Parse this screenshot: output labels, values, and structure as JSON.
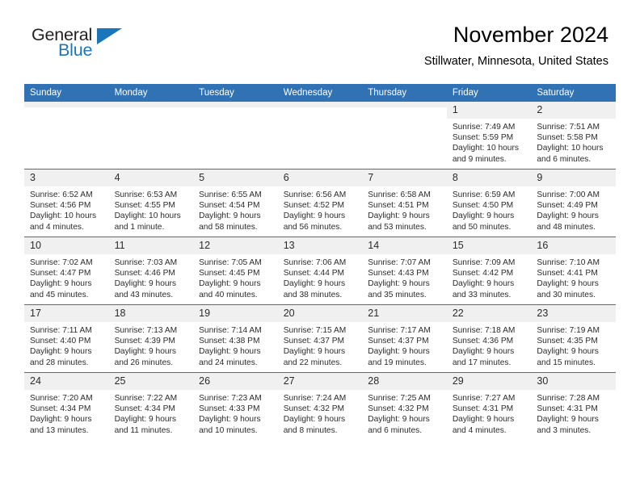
{
  "brand": {
    "name_part1": "General",
    "name_part2": "Blue",
    "flag_icon": "blue-triangle-flag",
    "accent_color": "#1b75bb"
  },
  "header": {
    "month_title": "November 2024",
    "location": "Stillwater, Minnesota, United States"
  },
  "calendar": {
    "header_color": "#3072b3",
    "daynum_band_color": "#f0f0f0",
    "weekday_headers": [
      "Sunday",
      "Monday",
      "Tuesday",
      "Wednesday",
      "Thursday",
      "Friday",
      "Saturday"
    ],
    "weeks": [
      [
        {
          "day": "",
          "empty": true
        },
        {
          "day": "",
          "empty": true
        },
        {
          "day": "",
          "empty": true
        },
        {
          "day": "",
          "empty": true
        },
        {
          "day": "",
          "empty": true
        },
        {
          "day": "1",
          "sunrise": "Sunrise: 7:49 AM",
          "sunset": "Sunset: 5:59 PM",
          "daylight": "Daylight: 10 hours and 9 minutes."
        },
        {
          "day": "2",
          "sunrise": "Sunrise: 7:51 AM",
          "sunset": "Sunset: 5:58 PM",
          "daylight": "Daylight: 10 hours and 6 minutes."
        }
      ],
      [
        {
          "day": "3",
          "sunrise": "Sunrise: 6:52 AM",
          "sunset": "Sunset: 4:56 PM",
          "daylight": "Daylight: 10 hours and 4 minutes."
        },
        {
          "day": "4",
          "sunrise": "Sunrise: 6:53 AM",
          "sunset": "Sunset: 4:55 PM",
          "daylight": "Daylight: 10 hours and 1 minute."
        },
        {
          "day": "5",
          "sunrise": "Sunrise: 6:55 AM",
          "sunset": "Sunset: 4:54 PM",
          "daylight": "Daylight: 9 hours and 58 minutes."
        },
        {
          "day": "6",
          "sunrise": "Sunrise: 6:56 AM",
          "sunset": "Sunset: 4:52 PM",
          "daylight": "Daylight: 9 hours and 56 minutes."
        },
        {
          "day": "7",
          "sunrise": "Sunrise: 6:58 AM",
          "sunset": "Sunset: 4:51 PM",
          "daylight": "Daylight: 9 hours and 53 minutes."
        },
        {
          "day": "8",
          "sunrise": "Sunrise: 6:59 AM",
          "sunset": "Sunset: 4:50 PM",
          "daylight": "Daylight: 9 hours and 50 minutes."
        },
        {
          "day": "9",
          "sunrise": "Sunrise: 7:00 AM",
          "sunset": "Sunset: 4:49 PM",
          "daylight": "Daylight: 9 hours and 48 minutes."
        }
      ],
      [
        {
          "day": "10",
          "sunrise": "Sunrise: 7:02 AM",
          "sunset": "Sunset: 4:47 PM",
          "daylight": "Daylight: 9 hours and 45 minutes."
        },
        {
          "day": "11",
          "sunrise": "Sunrise: 7:03 AM",
          "sunset": "Sunset: 4:46 PM",
          "daylight": "Daylight: 9 hours and 43 minutes."
        },
        {
          "day": "12",
          "sunrise": "Sunrise: 7:05 AM",
          "sunset": "Sunset: 4:45 PM",
          "daylight": "Daylight: 9 hours and 40 minutes."
        },
        {
          "day": "13",
          "sunrise": "Sunrise: 7:06 AM",
          "sunset": "Sunset: 4:44 PM",
          "daylight": "Daylight: 9 hours and 38 minutes."
        },
        {
          "day": "14",
          "sunrise": "Sunrise: 7:07 AM",
          "sunset": "Sunset: 4:43 PM",
          "daylight": "Daylight: 9 hours and 35 minutes."
        },
        {
          "day": "15",
          "sunrise": "Sunrise: 7:09 AM",
          "sunset": "Sunset: 4:42 PM",
          "daylight": "Daylight: 9 hours and 33 minutes."
        },
        {
          "day": "16",
          "sunrise": "Sunrise: 7:10 AM",
          "sunset": "Sunset: 4:41 PM",
          "daylight": "Daylight: 9 hours and 30 minutes."
        }
      ],
      [
        {
          "day": "17",
          "sunrise": "Sunrise: 7:11 AM",
          "sunset": "Sunset: 4:40 PM",
          "daylight": "Daylight: 9 hours and 28 minutes."
        },
        {
          "day": "18",
          "sunrise": "Sunrise: 7:13 AM",
          "sunset": "Sunset: 4:39 PM",
          "daylight": "Daylight: 9 hours and 26 minutes."
        },
        {
          "day": "19",
          "sunrise": "Sunrise: 7:14 AM",
          "sunset": "Sunset: 4:38 PM",
          "daylight": "Daylight: 9 hours and 24 minutes."
        },
        {
          "day": "20",
          "sunrise": "Sunrise: 7:15 AM",
          "sunset": "Sunset: 4:37 PM",
          "daylight": "Daylight: 9 hours and 22 minutes."
        },
        {
          "day": "21",
          "sunrise": "Sunrise: 7:17 AM",
          "sunset": "Sunset: 4:37 PM",
          "daylight": "Daylight: 9 hours and 19 minutes."
        },
        {
          "day": "22",
          "sunrise": "Sunrise: 7:18 AM",
          "sunset": "Sunset: 4:36 PM",
          "daylight": "Daylight: 9 hours and 17 minutes."
        },
        {
          "day": "23",
          "sunrise": "Sunrise: 7:19 AM",
          "sunset": "Sunset: 4:35 PM",
          "daylight": "Daylight: 9 hours and 15 minutes."
        }
      ],
      [
        {
          "day": "24",
          "sunrise": "Sunrise: 7:20 AM",
          "sunset": "Sunset: 4:34 PM",
          "daylight": "Daylight: 9 hours and 13 minutes."
        },
        {
          "day": "25",
          "sunrise": "Sunrise: 7:22 AM",
          "sunset": "Sunset: 4:34 PM",
          "daylight": "Daylight: 9 hours and 11 minutes."
        },
        {
          "day": "26",
          "sunrise": "Sunrise: 7:23 AM",
          "sunset": "Sunset: 4:33 PM",
          "daylight": "Daylight: 9 hours and 10 minutes."
        },
        {
          "day": "27",
          "sunrise": "Sunrise: 7:24 AM",
          "sunset": "Sunset: 4:32 PM",
          "daylight": "Daylight: 9 hours and 8 minutes."
        },
        {
          "day": "28",
          "sunrise": "Sunrise: 7:25 AM",
          "sunset": "Sunset: 4:32 PM",
          "daylight": "Daylight: 9 hours and 6 minutes."
        },
        {
          "day": "29",
          "sunrise": "Sunrise: 7:27 AM",
          "sunset": "Sunset: 4:31 PM",
          "daylight": "Daylight: 9 hours and 4 minutes."
        },
        {
          "day": "30",
          "sunrise": "Sunrise: 7:28 AM",
          "sunset": "Sunset: 4:31 PM",
          "daylight": "Daylight: 9 hours and 3 minutes."
        }
      ]
    ]
  }
}
